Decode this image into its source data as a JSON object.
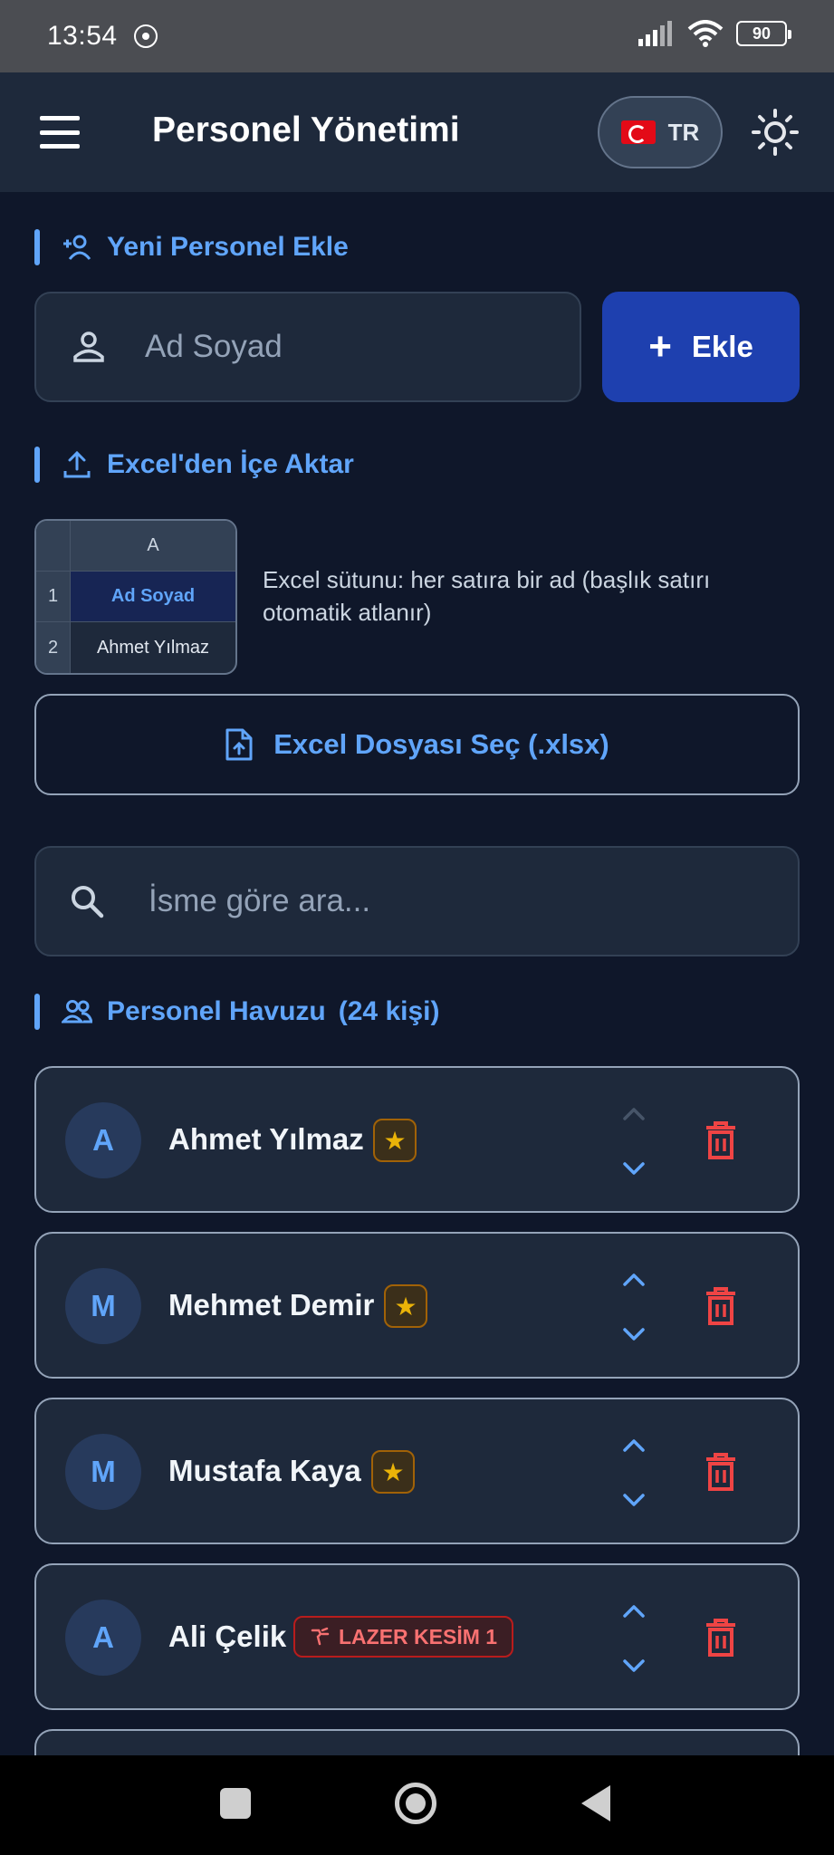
{
  "status_bar": {
    "time": "13:54",
    "battery": "90"
  },
  "app_bar": {
    "title": "Personel Yönetimi",
    "lang_code": "TR"
  },
  "add_section": {
    "title": "Yeni Personel Ekle",
    "name_placeholder": "Ad Soyad",
    "add_label": "Ekle"
  },
  "import_section": {
    "title": "Excel'den İçe Aktar",
    "preview": {
      "col_header": "A",
      "rows": [
        {
          "index": "1",
          "value": "Ad Soyad"
        },
        {
          "index": "2",
          "value": "Ahmet Yılmaz"
        }
      ]
    },
    "description": "Excel sütunu: her satıra bir ad (başlık satırı otomatik atlanır)",
    "file_button": "Excel Dosyası Seç (.xlsx)"
  },
  "search": {
    "placeholder": "İsme göre ara..."
  },
  "pool": {
    "title": "Personel Havuzu",
    "count": "(24 kişi)",
    "people": [
      {
        "initial": "A",
        "name": "Ahmet Yılmaz",
        "badge": "star"
      },
      {
        "initial": "M",
        "name": "Mehmet Demir",
        "badge": "star"
      },
      {
        "initial": "M",
        "name": "Mustafa Kaya",
        "badge": "star"
      },
      {
        "initial": "A",
        "name": "Ali Çelik",
        "badge": "tag",
        "tag_label": "LAZER KESİM 1"
      }
    ]
  },
  "colors": {
    "accent": "#60a5fa",
    "primary_button": "#1e40af",
    "danger": "#ef4444",
    "star": "#eab308"
  }
}
